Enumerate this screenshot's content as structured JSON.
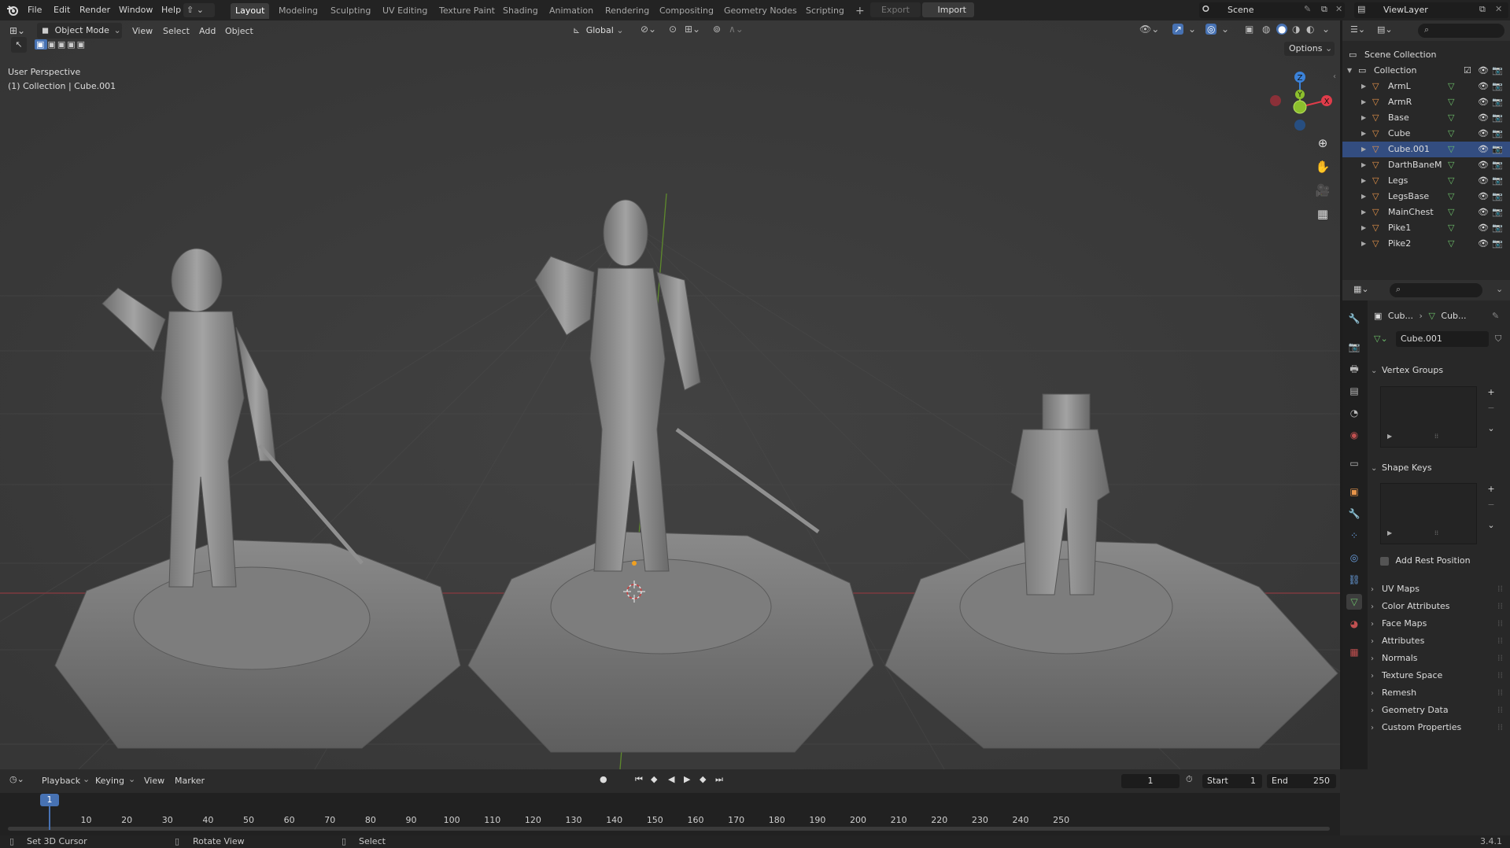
{
  "topbar": {
    "menus": [
      "File",
      "Edit",
      "Render",
      "Window",
      "Help"
    ],
    "workspaces": [
      "Layout",
      "Modeling",
      "Sculpting",
      "UV Editing",
      "Texture Paint",
      "Shading",
      "Animation",
      "Rendering",
      "Compositing",
      "Geometry Nodes",
      "Scripting"
    ],
    "active_workspace": "Layout",
    "add_tab": "+",
    "export_label": "Export",
    "import_label": "Import",
    "scene_label": "Scene",
    "viewlayer_label": "ViewLayer"
  },
  "viewport_header": {
    "mode": "Object Mode",
    "menus": [
      "View",
      "Select",
      "Add",
      "Object"
    ],
    "transform_orientation": "Global",
    "options_label": "Options"
  },
  "viewport": {
    "perspective_label": "User Perspective",
    "collection_label": "(1) Collection | Cube.001",
    "gizmo_axes": [
      "Z",
      "Y",
      "X"
    ]
  },
  "outliner": {
    "scene_collection": "Scene Collection",
    "collection": "Collection",
    "objects": [
      "ArmL",
      "ArmR",
      "Base",
      "Cube",
      "Cube.001",
      "DarthBaneM",
      "Legs",
      "LegsBase",
      "MainChest",
      "Pike1",
      "Pike2"
    ],
    "selected": "Cube.001"
  },
  "properties": {
    "breadcrumb_object": "Cub...",
    "breadcrumb_data": "Cub...",
    "mesh_name": "Cube.001",
    "panels": {
      "vertex_groups": "Vertex Groups",
      "shape_keys": "Shape Keys",
      "add_rest_position": "Add Rest Position",
      "collapsed": [
        "UV Maps",
        "Color Attributes",
        "Face Maps",
        "Attributes",
        "Normals",
        "Texture Space",
        "Remesh",
        "Geometry Data",
        "Custom Properties"
      ]
    }
  },
  "timeline": {
    "menus": [
      "Playback",
      "Keying",
      "View",
      "Marker"
    ],
    "current_frame": "1",
    "start_label": "Start",
    "start_value": "1",
    "end_label": "End",
    "end_value": "250",
    "ticks": [
      "1",
      "10",
      "20",
      "30",
      "40",
      "50",
      "60",
      "70",
      "80",
      "90",
      "100",
      "110",
      "120",
      "130",
      "140",
      "150",
      "160",
      "170",
      "180",
      "190",
      "200",
      "210",
      "220",
      "230",
      "240",
      "250"
    ]
  },
  "statusbar": {
    "hint1": "Set 3D Cursor",
    "hint2": "Rotate View",
    "hint3": "Select",
    "version": "3.4.1"
  },
  "colors": {
    "accent": "#4772b3",
    "selected_row": "#334d80",
    "x_axis": "#e03c4a",
    "y_axis": "#8cbf2d",
    "z_axis": "#3b82d9",
    "object_icon": "#e8954a",
    "mesh_data_icon": "#6dbf6a"
  }
}
